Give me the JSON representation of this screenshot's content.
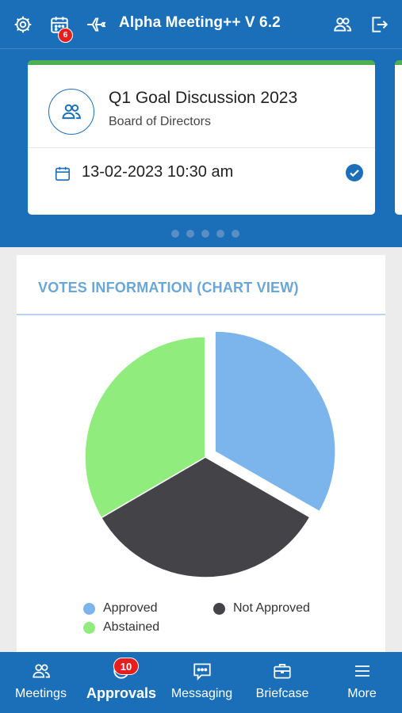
{
  "header": {
    "app_title": "Alpha Meeting++ V 6.2",
    "calendar_badge": "6",
    "icons": [
      "gear-icon",
      "calendar-icon",
      "airplane-icon",
      "users-icon",
      "logout-icon"
    ]
  },
  "meeting": {
    "title": "Q1 Goal Discussion 2023",
    "subtitle": "Board of Directors",
    "datetime": "13-02-2023 10:30 am",
    "status_color": "#4cb050"
  },
  "carousel": {
    "count": 5,
    "active_index": 0
  },
  "votes": {
    "title": "VOTES INFORMATION (CHART VIEW)"
  },
  "chart_data": {
    "type": "pie",
    "categories": [
      "Approved",
      "Not Approved",
      "Abstained"
    ],
    "values": [
      33.3,
      33.3,
      33.4
    ],
    "colors": [
      "#7cb5ec",
      "#434348",
      "#90ed7d"
    ],
    "exploded": "Approved",
    "legend_position": "bottom"
  },
  "nav": {
    "items": [
      {
        "label": "Meetings",
        "icon": "users-icon"
      },
      {
        "label": "Approvals",
        "icon": "approvals-icon",
        "badge": "10",
        "active": true
      },
      {
        "label": "Messaging",
        "icon": "chat-icon"
      },
      {
        "label": "Briefcase",
        "icon": "briefcase-icon"
      },
      {
        "label": "More",
        "icon": "menu-icon"
      }
    ]
  },
  "colors": {
    "primary": "#1a6fb8",
    "badge": "#e61e1e",
    "section_title": "#6aa6d6"
  }
}
